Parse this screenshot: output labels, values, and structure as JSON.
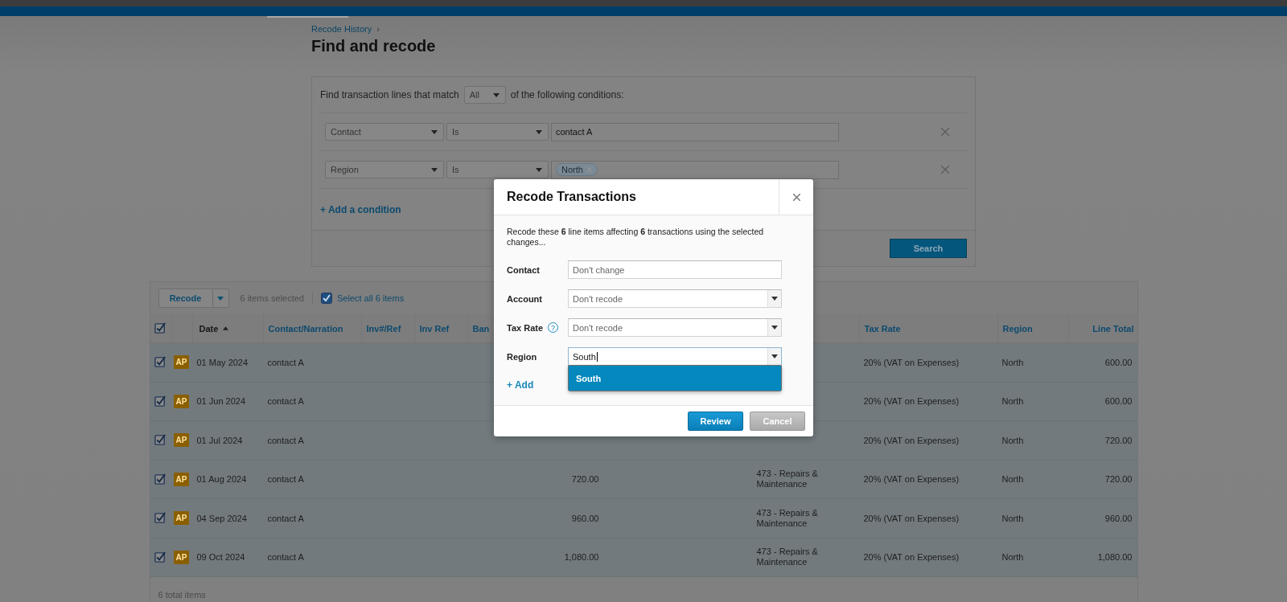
{
  "breadcrumb": {
    "label": "Recode History",
    "separator": "›"
  },
  "title": "Find and recode",
  "filter": {
    "lead": "Find transaction lines that match",
    "match": "All",
    "tail": "of the following conditions:",
    "conditions": [
      {
        "field": "Contact",
        "operator": "Is",
        "kind": "text",
        "value": "contact A"
      },
      {
        "field": "Region",
        "operator": "Is",
        "kind": "tokens",
        "tokens": [
          "North"
        ]
      }
    ],
    "add_label": "+ Add a condition",
    "search_button": "Search"
  },
  "results": {
    "recode_button": "Recode",
    "selected_count": "6 items selected",
    "select_all": {
      "label": "Select all 6 items",
      "checked": true
    },
    "header_checked": true,
    "columns": [
      {
        "label": "Date",
        "sorted": true
      },
      {
        "label": "Contact/Narration",
        "sorted": false
      },
      {
        "label": "Inv#/Ref",
        "sorted": false
      },
      {
        "label": "Inv Ref",
        "sorted": false
      },
      {
        "label": "Ban",
        "sorted": false
      },
      {
        "label": "Tax Rate",
        "sorted": false
      },
      {
        "label": "Region",
        "sorted": false
      },
      {
        "label": "Line Total",
        "sorted": false
      }
    ],
    "rows": [
      {
        "checked": true,
        "badge": "AP",
        "date": "01 May 2024",
        "contact": "contact A",
        "tax_rate": "20% (VAT on Expenses)",
        "region": "North",
        "line_total": "600.00"
      },
      {
        "checked": true,
        "badge": "AP",
        "date": "01 Jun 2024",
        "contact": "contact A",
        "tax_rate": "20% (VAT on Expenses)",
        "region": "North",
        "line_total": "600.00"
      },
      {
        "checked": true,
        "badge": "AP",
        "date": "01 Jul 2024",
        "contact": "contact A",
        "tax_rate": "20% (VAT on Expenses)",
        "region": "North",
        "line_total": "720.00"
      },
      {
        "checked": true,
        "badge": "AP",
        "date": "01 Aug 2024",
        "contact": "contact A",
        "amount": "720.00",
        "account": "473 - Repairs & Maintenance",
        "tax_rate": "20% (VAT on Expenses)",
        "region": "North",
        "line_total": "720.00"
      },
      {
        "checked": true,
        "badge": "AP",
        "date": "04 Sep 2024",
        "contact": "contact A",
        "amount": "960.00",
        "account": "473 - Repairs & Maintenance",
        "tax_rate": "20% (VAT on Expenses)",
        "region": "North",
        "line_total": "960.00"
      },
      {
        "checked": true,
        "badge": "AP",
        "date": "09 Oct 2024",
        "contact": "contact A",
        "amount": "1,080.00",
        "account": "473 - Repairs & Maintenance",
        "tax_rate": "20% (VAT on Expenses)",
        "region": "North",
        "line_total": "1,080.00"
      }
    ],
    "footer": "6 total items"
  },
  "modal": {
    "title": "Recode Transactions",
    "intro": "Recode these **6** line items affecting **6** transactions using the selected changes...",
    "fields": [
      {
        "label": "Contact",
        "kind": "text",
        "placeholder": "Don't change"
      },
      {
        "label": "Account",
        "kind": "select",
        "open": false,
        "placeholder": "Don't recode"
      },
      {
        "label": "Tax Rate",
        "kind": "select",
        "help": "?",
        "open": false,
        "placeholder": "Don't recode"
      },
      {
        "label": "Region",
        "kind": "select",
        "value": "South",
        "open": true,
        "options": [
          {
            "label": "South",
            "selected": true
          }
        ]
      }
    ],
    "add_label": "+ Add",
    "buttons": [
      {
        "label": "Review",
        "kind": "primary"
      },
      {
        "label": "Cancel",
        "kind": "secondary"
      }
    ]
  }
}
